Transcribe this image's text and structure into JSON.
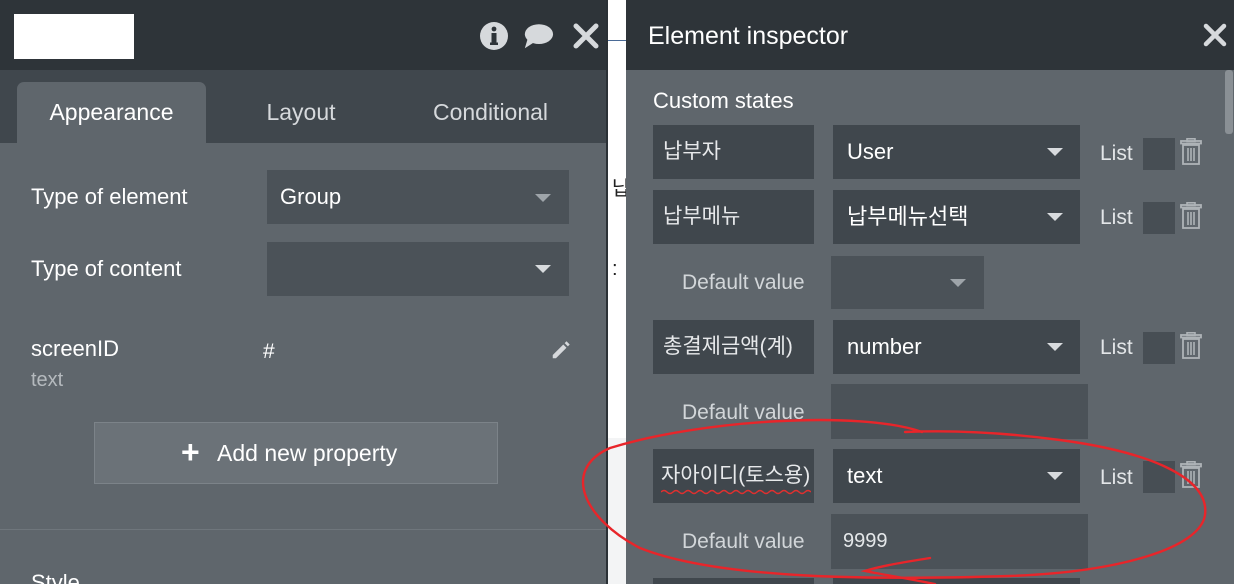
{
  "left_panel": {
    "tabs": [
      "Appearance",
      "Layout",
      "Conditional"
    ],
    "type_of_element_label": "Type of element",
    "type_of_element_value": "Group",
    "type_of_content_label": "Type of content",
    "type_of_content_value": "",
    "property_name": "screenID",
    "property_type": "text",
    "property_value": "#",
    "add_property_label": "Add new property",
    "style_label": "Style"
  },
  "canvas": {
    "char_1": "납",
    "char_2": ":"
  },
  "inspector": {
    "title": "Element inspector",
    "section_title": "Custom states",
    "list_label": "List",
    "default_label": "Default value",
    "states": [
      {
        "name": "납부자",
        "type": "User"
      },
      {
        "name": "납부메뉴",
        "type": "납부메뉴선택",
        "default_value": ""
      },
      {
        "name": "총결제금액(계)",
        "type": "number",
        "default_value": ""
      },
      {
        "name": "자아이디(토스용)",
        "type": "text",
        "default_value": "9999"
      }
    ]
  },
  "colors": {
    "header_bg": "#2e3439",
    "panel_bg": "#5f666c",
    "annotation_red": "#e8252a"
  }
}
